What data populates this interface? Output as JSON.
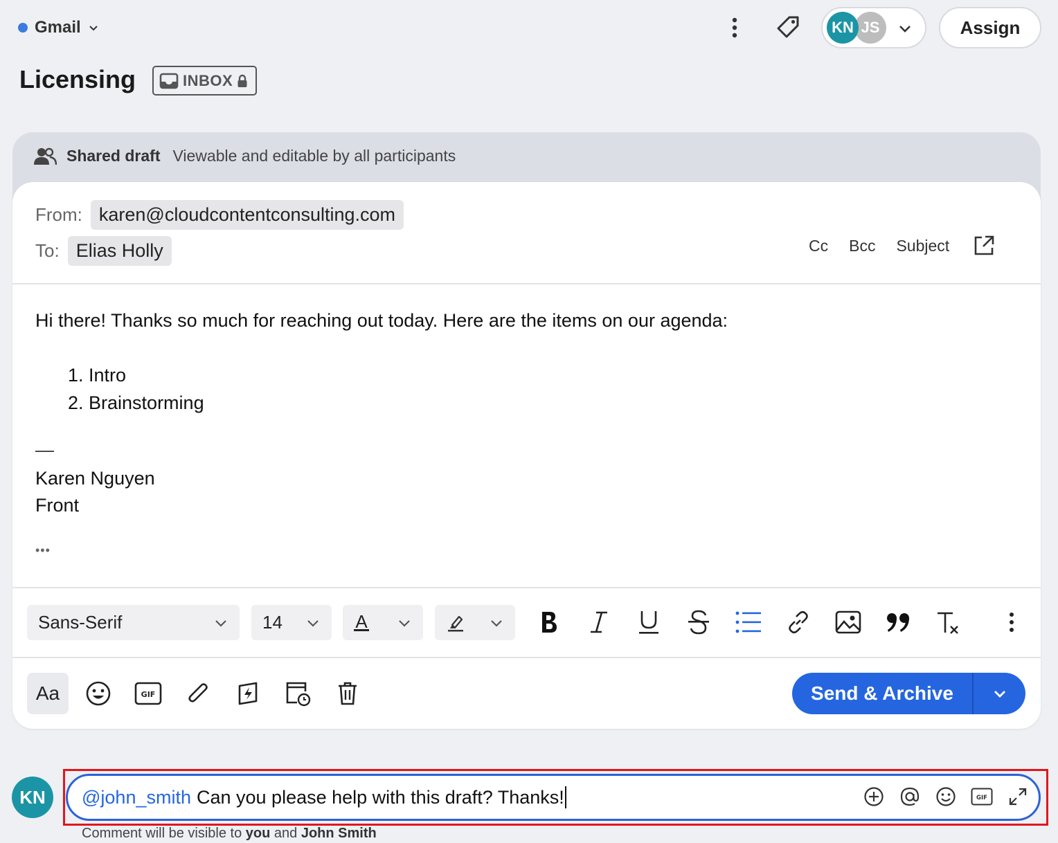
{
  "topbar": {
    "inbox_name": "Gmail",
    "assignee_initials_1": "KN",
    "assignee_initials_2": "JS",
    "assign_label": "Assign"
  },
  "conversation": {
    "title": "Licensing",
    "badge": "INBOX"
  },
  "shared_draft": {
    "label": "Shared draft",
    "description": "Viewable and editable by all participants"
  },
  "compose": {
    "from_label": "From:",
    "from_value": "karen@cloudcontentconsulting.com",
    "to_label": "To:",
    "to_value": "Elias Holly",
    "cc_label": "Cc",
    "bcc_label": "Bcc",
    "subject_label": "Subject",
    "body_intro": "Hi there! Thanks so much for reaching out today. Here are the items on our agenda:",
    "agenda": [
      "1. Intro",
      "2. Brainstorming"
    ],
    "signature_dash": "—",
    "signature_name": "Karen Nguyen",
    "signature_company": "Front",
    "ellipsis": "•••"
  },
  "toolbar": {
    "font_family": "Sans-Serif",
    "font_size": "14",
    "text_color_glyph": "A"
  },
  "bottom": {
    "aa_label": "Aa",
    "send_label": "Send & Archive"
  },
  "comment": {
    "avatar_initials": "KN",
    "mention": "@john_smith",
    "text": "Can you please help with this draft? Thanks!",
    "note_prefix": "Comment will be visible to",
    "note_you": "you",
    "note_and": "and",
    "note_user": "John Smith"
  },
  "colors": {
    "accent": "#2566e0",
    "avatar_teal": "#1b95a5",
    "highlight_outline": "#e0171d"
  }
}
